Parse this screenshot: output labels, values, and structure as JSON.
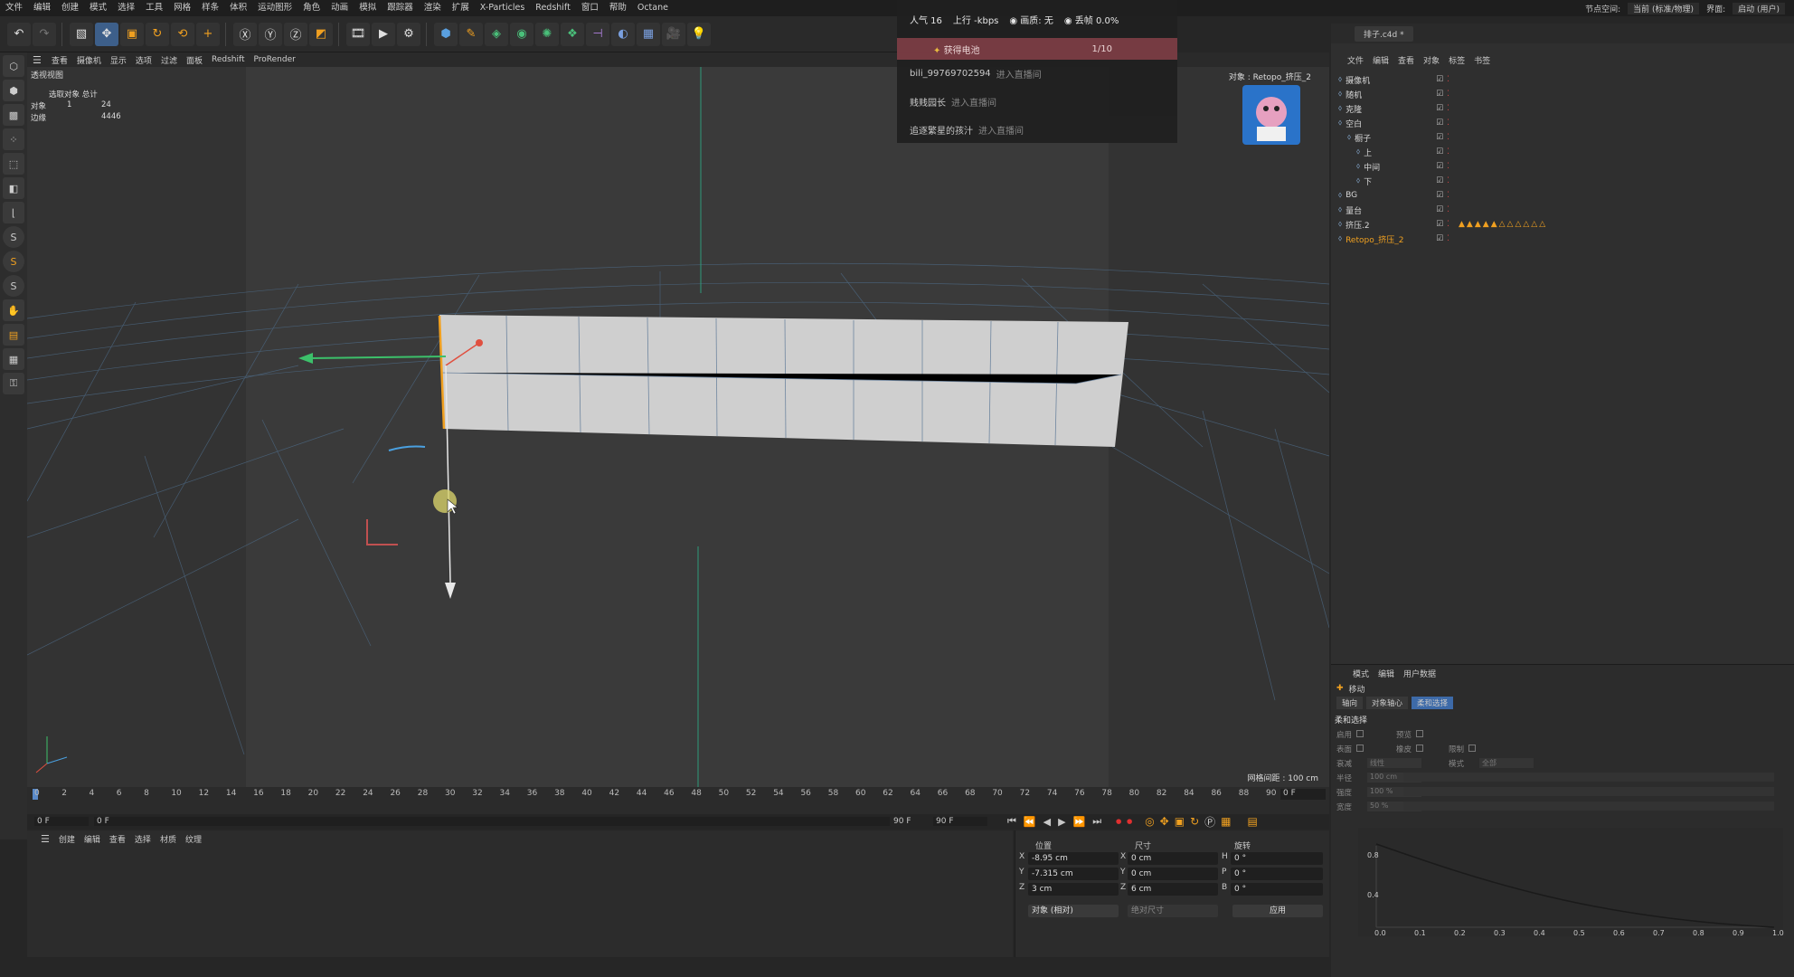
{
  "menu": [
    "文件",
    "编辑",
    "创建",
    "模式",
    "选择",
    "工具",
    "网格",
    "样条",
    "体积",
    "运动图形",
    "角色",
    "动画",
    "模拟",
    "跟踪器",
    "渲染",
    "扩展",
    "X-Particles",
    "Redshift",
    "窗口",
    "帮助",
    "Octane"
  ],
  "top_right": {
    "node_space_label": "节点空间:",
    "node_space_value": "当前 (标准/物理)",
    "layout_label": "界面:",
    "layout_value": "启动 (用户)"
  },
  "viewport_menu": [
    "查看",
    "摄像机",
    "显示",
    "选项",
    "过滤",
    "面板",
    "Redshift",
    "ProRender"
  ],
  "viewport": {
    "title": "透视视图",
    "stats_header": "选取对象 总计",
    "stats": [
      {
        "label": "对象",
        "a": "1",
        "b": "24"
      },
      {
        "label": "边缘",
        "a": "",
        "b": "4446"
      }
    ],
    "object_label": "对象 : Retopo_挤压_2",
    "grid_spacing": "网格间距 : 100 cm"
  },
  "live_overlay": {
    "popularity": "人气 16",
    "upload": "上行 -kbps",
    "quality": "画质: 无",
    "drop": "丢帧 0.0%",
    "battery_label": "获得电池",
    "battery_count": "1/10",
    "entries": [
      {
        "user": "bili_99769702594",
        "action": "进入直播间"
      },
      {
        "user": "贱贱园长",
        "action": "进入直播间"
      },
      {
        "user": "追逐繁星的孩汁",
        "action": "进入直播间"
      }
    ]
  },
  "timeline": {
    "ticks": [
      "0",
      "2",
      "4",
      "6",
      "8",
      "10",
      "12",
      "14",
      "16",
      "18",
      "20",
      "22",
      "24",
      "26",
      "28",
      "30",
      "32",
      "34",
      "36",
      "38",
      "40",
      "42",
      "44",
      "46",
      "48",
      "50",
      "52",
      "54",
      "56",
      "58",
      "60",
      "62",
      "64",
      "66",
      "68",
      "70",
      "72",
      "74",
      "76",
      "78",
      "80",
      "82",
      "84",
      "86",
      "88",
      "90"
    ],
    "current": "0 F",
    "start": "0 F",
    "start2": "0 F",
    "end": "90 F",
    "end2": "90 F"
  },
  "material_menu": [
    "创建",
    "编辑",
    "查看",
    "选择",
    "材质",
    "纹理"
  ],
  "coords": {
    "headers": [
      "位置",
      "尺寸",
      "旋转"
    ],
    "rows": [
      {
        "axis": "X",
        "pos": "-8.95 cm",
        "saxis": "X",
        "size": "0 cm",
        "raxis": "H",
        "rot": "0 °"
      },
      {
        "axis": "Y",
        "pos": "-7.315 cm",
        "saxis": "Y",
        "size": "0 cm",
        "raxis": "P",
        "rot": "0 °"
      },
      {
        "axis": "Z",
        "pos": "3 cm",
        "saxis": "Z",
        "size": "6 cm",
        "raxis": "B",
        "rot": "0 °"
      }
    ],
    "mode": "对象 (相对)",
    "size_mode": "绝对尺寸",
    "apply": "应用"
  },
  "object_manager": {
    "file_tab": "排子.c4d *",
    "menu": [
      "文件",
      "编辑",
      "查看",
      "对象",
      "标签",
      "书签"
    ],
    "objects": [
      {
        "name": "摄像机",
        "indent": 0,
        "orange": false
      },
      {
        "name": "随机",
        "indent": 0,
        "orange": false
      },
      {
        "name": "克隆",
        "indent": 0,
        "orange": false
      },
      {
        "name": "空白",
        "indent": 0,
        "orange": false
      },
      {
        "name": "橱子",
        "indent": 1,
        "orange": false
      },
      {
        "name": "上",
        "indent": 2,
        "orange": false
      },
      {
        "name": "中间",
        "indent": 2,
        "orange": false
      },
      {
        "name": "下",
        "indent": 2,
        "orange": false
      },
      {
        "name": "BG",
        "indent": 0,
        "orange": false
      },
      {
        "name": "量台",
        "indent": 0,
        "orange": false
      },
      {
        "name": "挤压.2",
        "indent": 0,
        "orange": false
      },
      {
        "name": "Retopo_挤压_2",
        "indent": 0,
        "orange": true
      }
    ]
  },
  "attributes": {
    "menu": [
      "模式",
      "编辑",
      "用户数据"
    ],
    "tool": "移动",
    "tabs": [
      "轴向",
      "对象轴心",
      "柔和选择"
    ],
    "section": "柔和选择",
    "fields": [
      {
        "label": "启用",
        "value": ""
      },
      {
        "label": "预览",
        "value": ""
      },
      {
        "label": "表面",
        "value": ""
      },
      {
        "label": "橡皮",
        "value": ""
      },
      {
        "label": "限制",
        "value": ""
      },
      {
        "label": "衰减",
        "value": "线性"
      },
      {
        "label": "模式",
        "value": "全部"
      },
      {
        "label": "半径",
        "value": "100 cm"
      },
      {
        "label": "强度",
        "value": "100 %"
      },
      {
        "label": "宽度",
        "value": "50 %"
      }
    ],
    "graph_y": [
      "0.8",
      "0.4"
    ],
    "graph_x": [
      "0.0",
      "0.1",
      "0.2",
      "0.3",
      "0.4",
      "0.5",
      "0.6",
      "0.7",
      "0.8",
      "0.9",
      "1.0"
    ]
  },
  "colors": {
    "accent": "#f0a020",
    "selected_tab": "#3d6aa8",
    "battery": "#7a3c44"
  }
}
